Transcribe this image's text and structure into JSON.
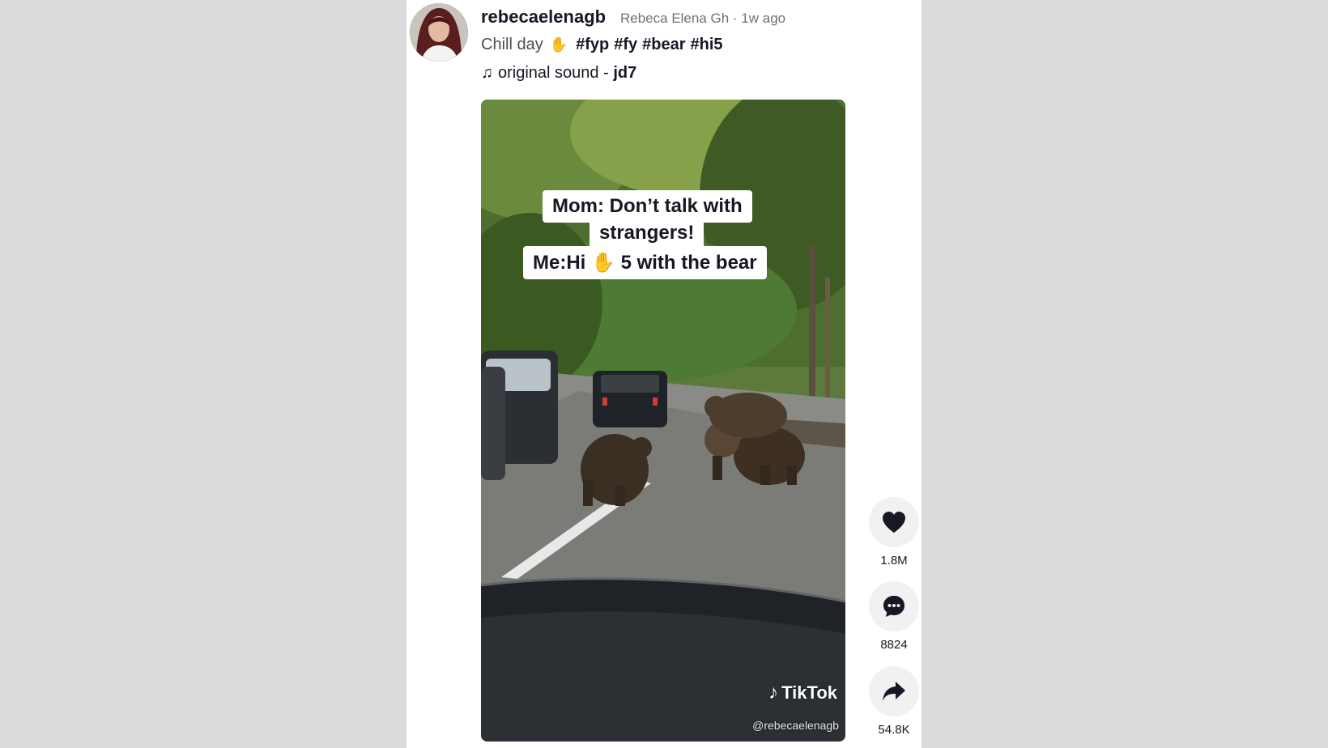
{
  "author": {
    "username": "rebecaelenagb",
    "display_name": "Rebeca Elena Gh",
    "posted": "1w ago",
    "meta_line": "Rebeca Elena Gh · 1w ago"
  },
  "caption": {
    "text": "Chill day",
    "emoji": "waving-hand",
    "hashtags": [
      "#fyp",
      "#fy",
      "#bear",
      "#hi5"
    ]
  },
  "sound": {
    "prefix": "original sound - ",
    "artist": "jd7",
    "icon": "music-note-icon"
  },
  "video": {
    "overlay_line1": "Mom: Don’t talk with",
    "overlay_line2": "strangers!",
    "overlay_line3_before": "Me:Hi",
    "overlay_line3_after": "5 with the bear",
    "watermark": "TikTok",
    "watermark_handle": "@rebecaelenagb"
  },
  "actions": {
    "likes": "1.8M",
    "comments": "8824",
    "shares": "54.8K"
  },
  "colors": {
    "background": "#dcdcdc",
    "panel": "#ffffff",
    "action_circle": "#f1f1f2",
    "text": "#161823",
    "muted": "#6f7079"
  }
}
